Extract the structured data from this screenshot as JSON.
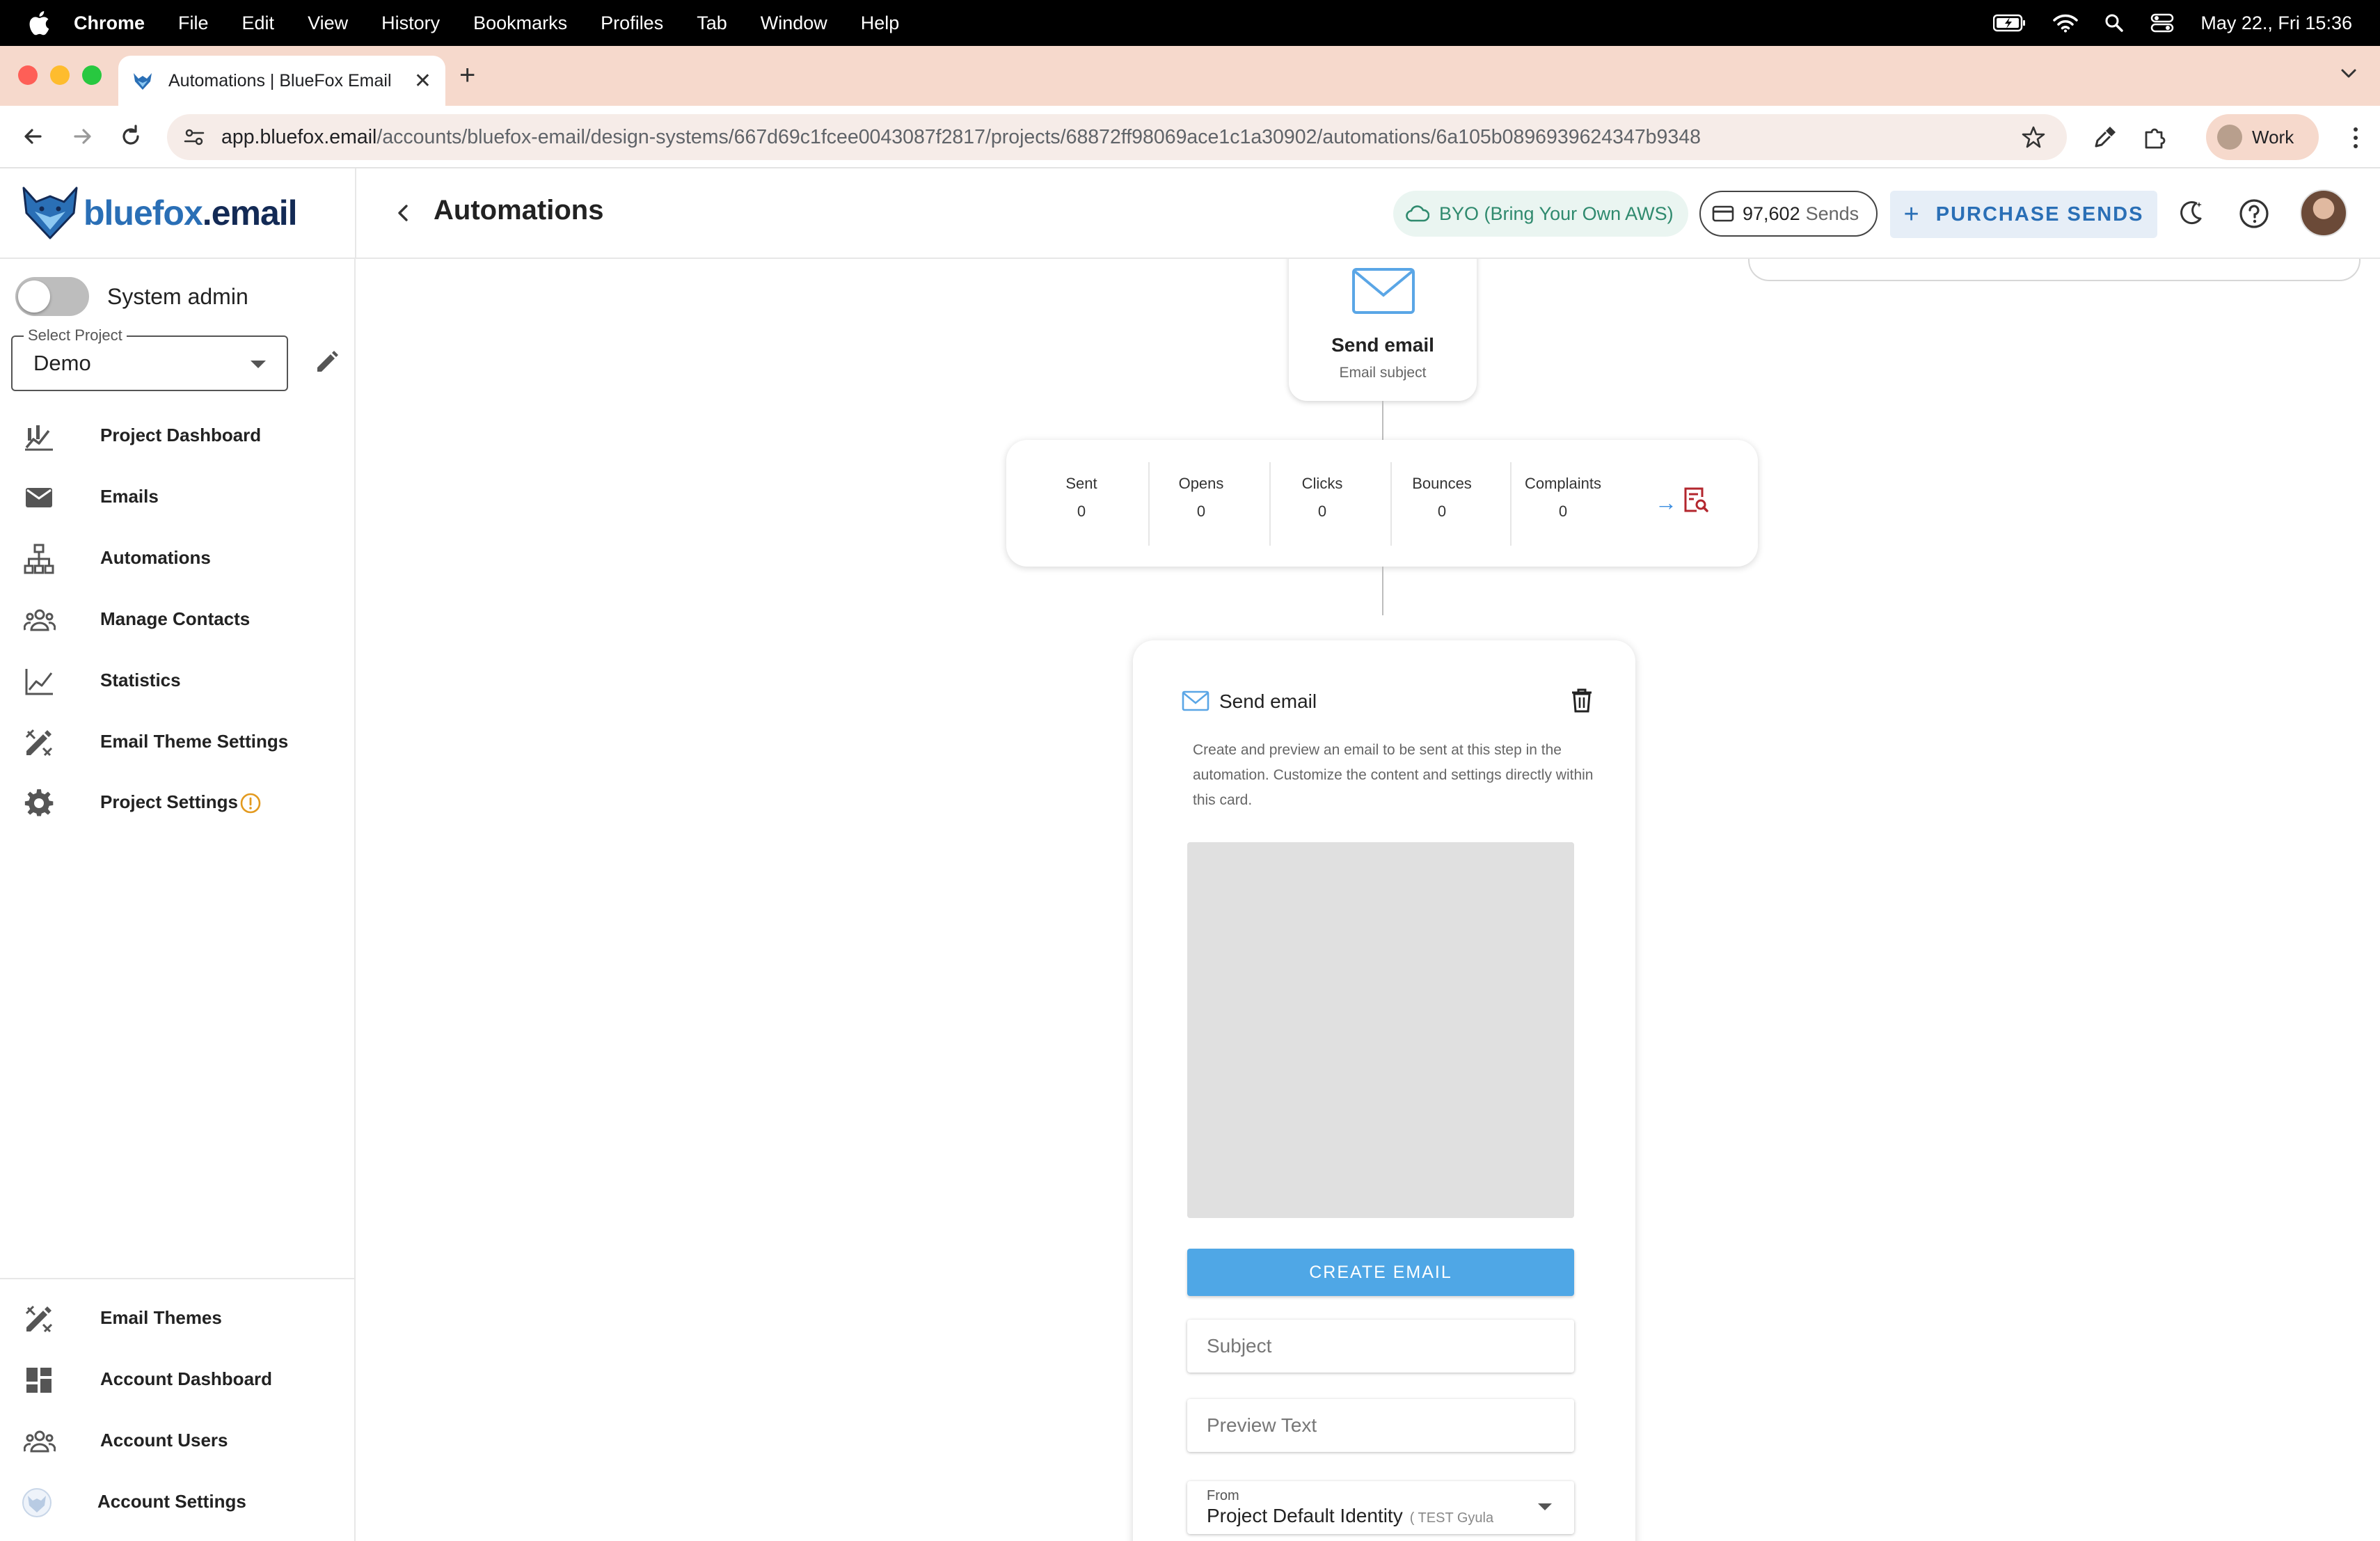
{
  "menubar": {
    "app_name": "Chrome",
    "items": [
      "File",
      "Edit",
      "View",
      "History",
      "Bookmarks",
      "Profiles",
      "Tab",
      "Window",
      "Help"
    ],
    "datetime": "May 22., Fri 15:36"
  },
  "browser": {
    "tab_title": "Automations | BlueFox Email",
    "url_host": "app.bluefox.email",
    "url_path": "/accounts/bluefox-email/design-systems/667d69c1fcee0043087f2817/projects/68872ff98069ace1c1a30902/automations/6a105b0896939624347b9348",
    "profile_label": "Work"
  },
  "header": {
    "logo_text_main": "bluefox",
    "logo_text_tld": ".email",
    "page_title": "Automations",
    "byo_label": "BYO (Bring Your Own AWS)",
    "sends_count": "97,602",
    "sends_unit": "Sends",
    "purchase_label": "PURCHASE SENDS"
  },
  "sidebar": {
    "system_admin_label": "System admin",
    "select_project_label": "Select Project",
    "select_project_value": "Demo",
    "items": [
      {
        "label": "Project Dashboard",
        "icon": "chart-icon"
      },
      {
        "label": "Emails",
        "icon": "mail-icon"
      },
      {
        "label": "Automations",
        "icon": "hierarchy-icon"
      },
      {
        "label": "Manage Contacts",
        "icon": "people-icon"
      },
      {
        "label": "Statistics",
        "icon": "line-chart-icon"
      },
      {
        "label": "Email Theme Settings",
        "icon": "design-tools-icon"
      },
      {
        "label": "Project Settings",
        "icon": "gear-icon"
      }
    ],
    "bottom_items": [
      {
        "label": "Email Themes",
        "icon": "design-tools-icon"
      },
      {
        "label": "Account Dashboard",
        "icon": "dashboard-icon"
      },
      {
        "label": "Account Users",
        "icon": "people-icon"
      },
      {
        "label": "Account Settings",
        "icon": "fox-logo-icon"
      }
    ]
  },
  "canvas": {
    "node": {
      "title": "Send email",
      "subtitle": "Email subject"
    },
    "stats": [
      {
        "label": "Sent",
        "value": "0"
      },
      {
        "label": "Opens",
        "value": "0"
      },
      {
        "label": "Clicks",
        "value": "0"
      },
      {
        "label": "Bounces",
        "value": "0"
      },
      {
        "label": "Complaints",
        "value": "0"
      }
    ],
    "stats_arrow": "→",
    "email_card": {
      "title": "Send email",
      "description": "Create and preview an email to be sent at this step in the automation. Customize the content and settings directly within this card.",
      "create_label": "CREATE EMAIL",
      "subject_placeholder": "Subject",
      "preview_placeholder": "Preview Text",
      "from_label": "From",
      "from_value": "Project Default Identity",
      "from_sub": "( TEST Gyula"
    }
  },
  "colors": {
    "accent": "#2a6fb6",
    "create_button": "#4fa7e6",
    "byo_text": "#2f8a6e",
    "tabstrip": "#f6d9cc",
    "warning": "#e39a1f"
  }
}
